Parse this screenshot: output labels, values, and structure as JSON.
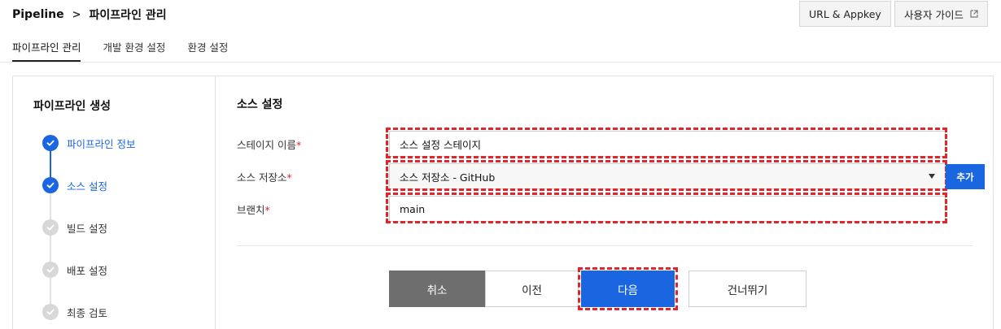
{
  "breadcrumb": {
    "root": "Pipeline",
    "separator": ">",
    "current": "파이프라인 관리"
  },
  "header_buttons": {
    "appkey": "URL & Appkey",
    "guide": "사용자 가이드"
  },
  "tabs": [
    {
      "label": "파이프라인 관리",
      "active": true
    },
    {
      "label": "개발 환경 설정",
      "active": false
    },
    {
      "label": "환경 설정",
      "active": false
    }
  ],
  "wizard": {
    "title": "파이프라인 생성",
    "steps": [
      {
        "label": "파이프라인 정보",
        "status": "done"
      },
      {
        "label": "소스 설정",
        "status": "done"
      },
      {
        "label": "빌드 설정",
        "status": "todo"
      },
      {
        "label": "배포 설정",
        "status": "todo"
      },
      {
        "label": "최종 검토",
        "status": "todo"
      }
    ]
  },
  "form": {
    "section_title": "소스 설정",
    "required_mark": "*",
    "stage_name": {
      "label": "스테이지 이름",
      "value": "소스 설정 스테이지"
    },
    "repository": {
      "label": "소스 저장소",
      "value": "소스 저장소 - GitHub",
      "add_label": "추가"
    },
    "branch": {
      "label": "브랜치",
      "value": "main"
    }
  },
  "actions": {
    "cancel": "취소",
    "prev": "이전",
    "next": "다음",
    "skip": "건너뛰기"
  },
  "colors": {
    "accent": "#1a66e0",
    "highlight": "#e0252d",
    "cancel_bg": "#6e6e6e"
  }
}
